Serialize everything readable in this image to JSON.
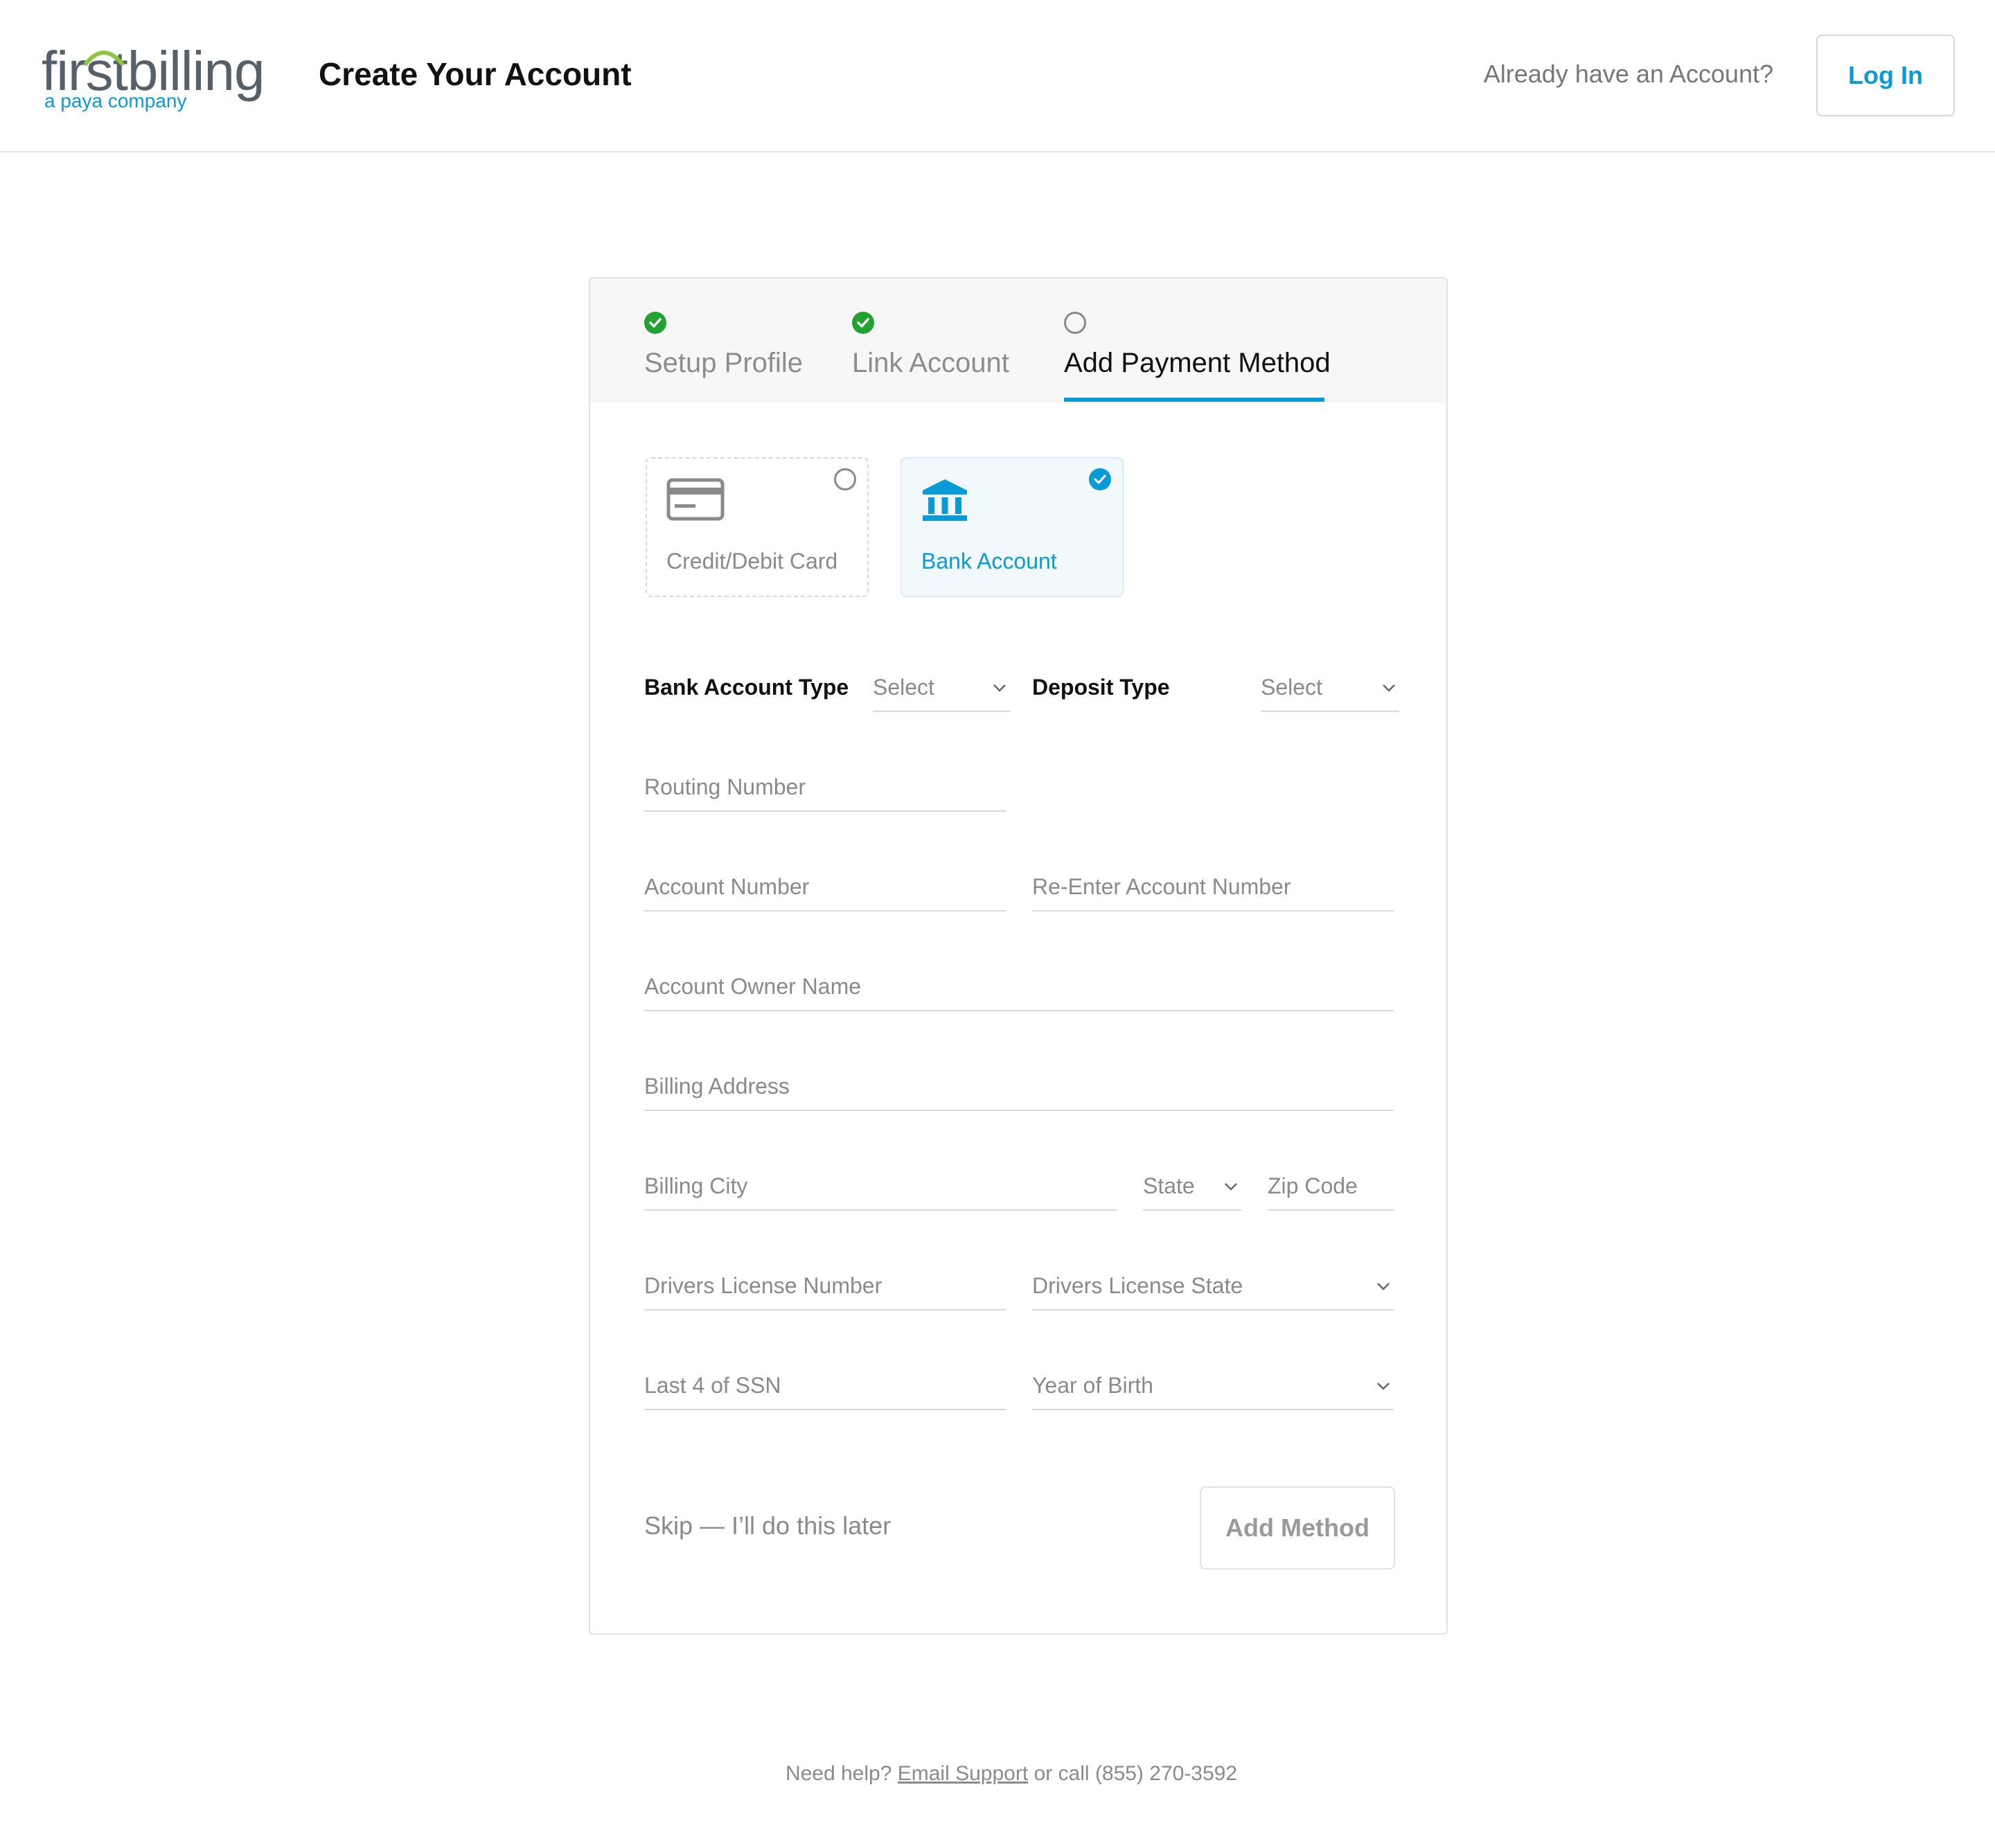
{
  "header": {
    "logo_main": "firstbilling",
    "logo_sub": "a paya company",
    "title": "Create Your Account",
    "already_text": "Already have an Account?",
    "login_label": "Log In"
  },
  "steps": [
    {
      "label": "Setup Profile",
      "status": "done"
    },
    {
      "label": "Link Account",
      "status": "done"
    },
    {
      "label": "Add Payment Method",
      "status": "active"
    }
  ],
  "methods": {
    "card_label": "Credit/Debit Card",
    "bank_label": "Bank Account",
    "selected": "Bank Account"
  },
  "form": {
    "bank_account_type_label": "Bank Account Type",
    "bank_account_type_value": "Select",
    "deposit_type_label": "Deposit Type",
    "deposit_type_value": "Select",
    "routing_number": "Routing Number",
    "account_number": "Account Number",
    "reenter_account_number": "Re-Enter Account Number",
    "account_owner_name": "Account Owner Name",
    "billing_address": "Billing Address",
    "billing_city": "Billing City",
    "state": "State",
    "zip_code": "Zip Code",
    "drivers_license_number": "Drivers License Number",
    "drivers_license_state": "Drivers License State",
    "last4_ssn": "Last 4 of SSN",
    "year_of_birth": "Year of Birth"
  },
  "actions": {
    "skip_label": "Skip — I’ll do this later",
    "add_method_label": "Add Method"
  },
  "footer": {
    "help_text": "Need help?",
    "email_link": "Email Support",
    "call_text": "or call (855) 270-3592"
  },
  "colors": {
    "accent": "#0a9ad6",
    "success": "#22a230",
    "logo_gray": "#55606a"
  }
}
